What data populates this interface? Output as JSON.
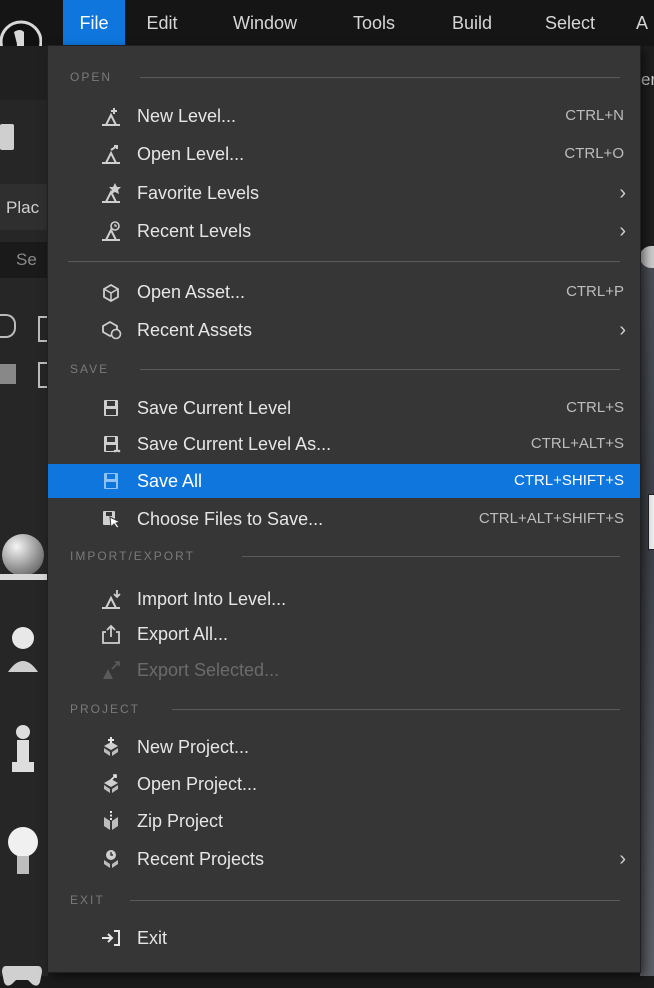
{
  "menubar": {
    "items": [
      {
        "label": "File",
        "active": true
      },
      {
        "label": "Edit"
      },
      {
        "label": "Window"
      },
      {
        "label": "Tools"
      },
      {
        "label": "Build"
      },
      {
        "label": "Select"
      },
      {
        "label": "A"
      }
    ]
  },
  "background": {
    "places_tab": "Plac",
    "search_hint": "Se",
    "right_fragment": "er"
  },
  "menu": {
    "sections": {
      "open": "OPEN",
      "save": "SAVE",
      "import_export": "IMPORT/EXPORT",
      "project": "PROJECT",
      "exit": "EXIT"
    },
    "items": {
      "new_level": {
        "label": "New Level...",
        "shortcut": "CTRL+N",
        "icon": "new-level-icon"
      },
      "open_level": {
        "label": "Open Level...",
        "shortcut": "CTRL+O",
        "icon": "open-level-icon"
      },
      "favorite_levels": {
        "label": "Favorite Levels",
        "icon": "favorite-levels-icon"
      },
      "recent_levels": {
        "label": "Recent Levels",
        "icon": "recent-levels-icon"
      },
      "open_asset": {
        "label": "Open Asset...",
        "shortcut": "CTRL+P",
        "icon": "open-asset-icon"
      },
      "recent_assets": {
        "label": "Recent Assets",
        "icon": "recent-assets-icon"
      },
      "save_current_level": {
        "label": "Save Current Level",
        "shortcut": "CTRL+S",
        "icon": "save-icon"
      },
      "save_current_level_as": {
        "label": "Save Current Level As...",
        "shortcut": "CTRL+ALT+S",
        "icon": "save-as-icon"
      },
      "save_all": {
        "label": "Save All",
        "shortcut": "CTRL+SHIFT+S",
        "icon": "save-all-icon"
      },
      "choose_files": {
        "label": "Choose Files to Save...",
        "shortcut": "CTRL+ALT+SHIFT+S",
        "icon": "choose-files-icon"
      },
      "import_into_level": {
        "label": "Import Into Level...",
        "icon": "import-icon"
      },
      "export_all": {
        "label": "Export All...",
        "icon": "export-icon"
      },
      "export_selected": {
        "label": "Export Selected...",
        "icon": "export-selected-icon"
      },
      "new_project": {
        "label": "New Project...",
        "icon": "new-project-icon"
      },
      "open_project": {
        "label": "Open Project...",
        "icon": "open-project-icon"
      },
      "zip_project": {
        "label": "Zip Project",
        "icon": "zip-project-icon"
      },
      "recent_projects": {
        "label": "Recent Projects",
        "icon": "recent-projects-icon"
      },
      "exit": {
        "label": "Exit",
        "icon": "exit-icon"
      }
    },
    "submenu_arrow": "›"
  },
  "colors": {
    "accent": "#0e76dc",
    "menu_bg": "#363636",
    "menubar_bg": "#151515"
  }
}
